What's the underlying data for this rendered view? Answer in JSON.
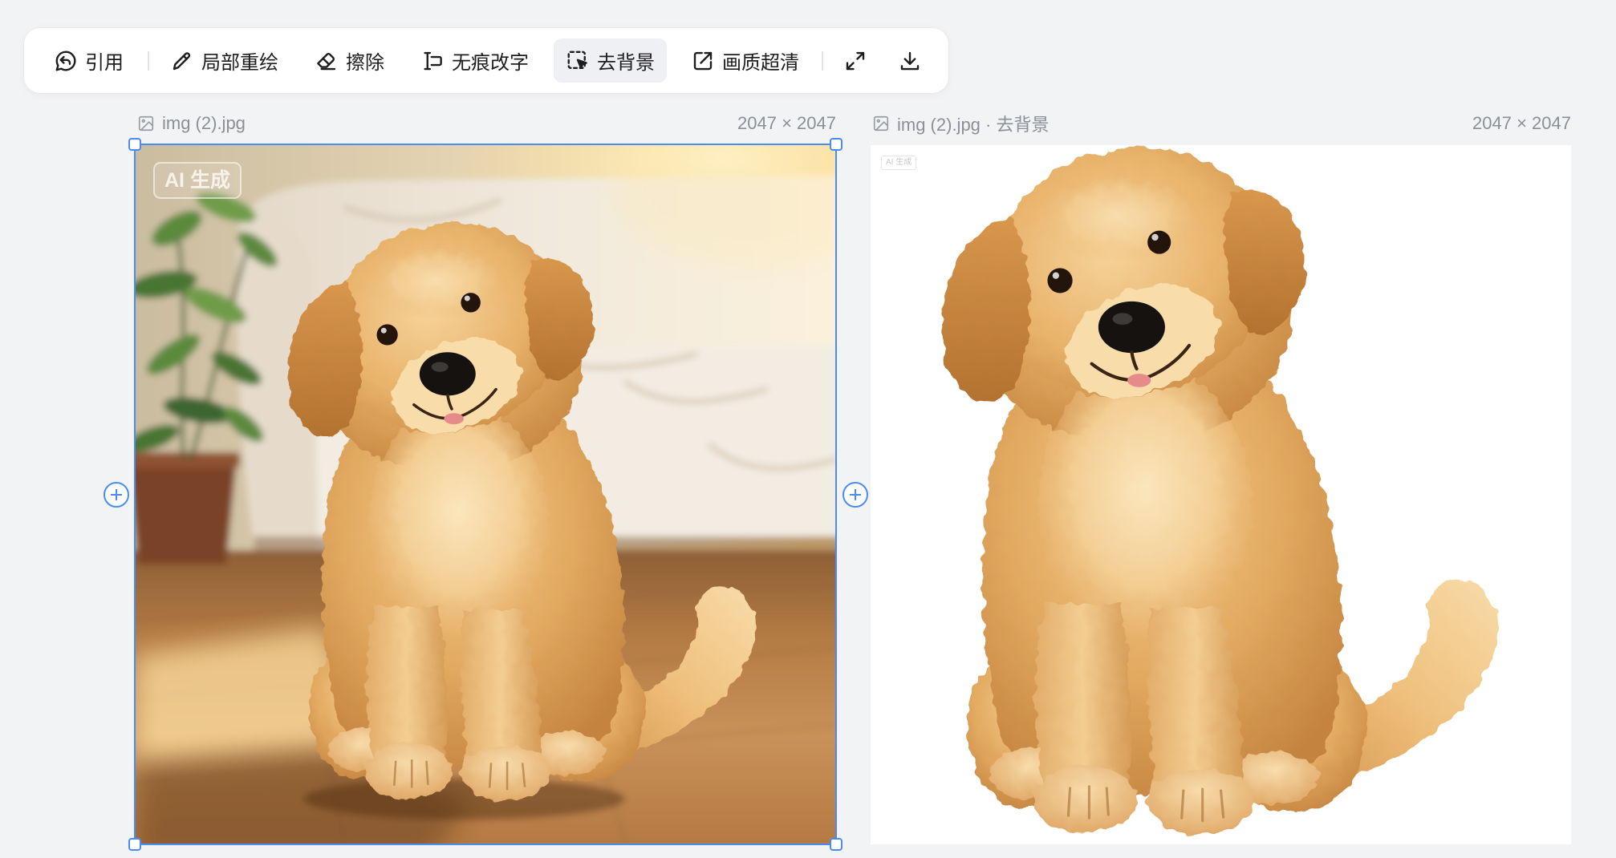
{
  "toolbar": {
    "items": [
      {
        "label": "引用",
        "icon": "quote-reply-icon"
      },
      {
        "label": "局部重绘",
        "icon": "pencil-icon"
      },
      {
        "label": "擦除",
        "icon": "eraser-icon"
      },
      {
        "label": "无痕改字",
        "icon": "text-edit-icon"
      },
      {
        "label": "去背景",
        "icon": "remove-background-icon",
        "active": true
      },
      {
        "label": "画质超清",
        "icon": "upscale-icon"
      }
    ],
    "expand_icon": "expand-icon",
    "download_icon": "download-icon"
  },
  "canvas": {
    "original": {
      "filename": "img (2).jpg",
      "dimensions": "2047 × 2047",
      "badge": "AI 生成",
      "selected": true
    },
    "result": {
      "filename": "img (2).jpg · 去背景",
      "dimensions": "2047 × 2047",
      "badge": "AI 生成"
    }
  },
  "colors": {
    "accent": "#4a8cf7",
    "background": "#f2f3f5",
    "toolbar": "#ffffff",
    "active_item": "#eef0f3",
    "text": "#1d1d1f",
    "muted_text": "#8b8f96"
  }
}
